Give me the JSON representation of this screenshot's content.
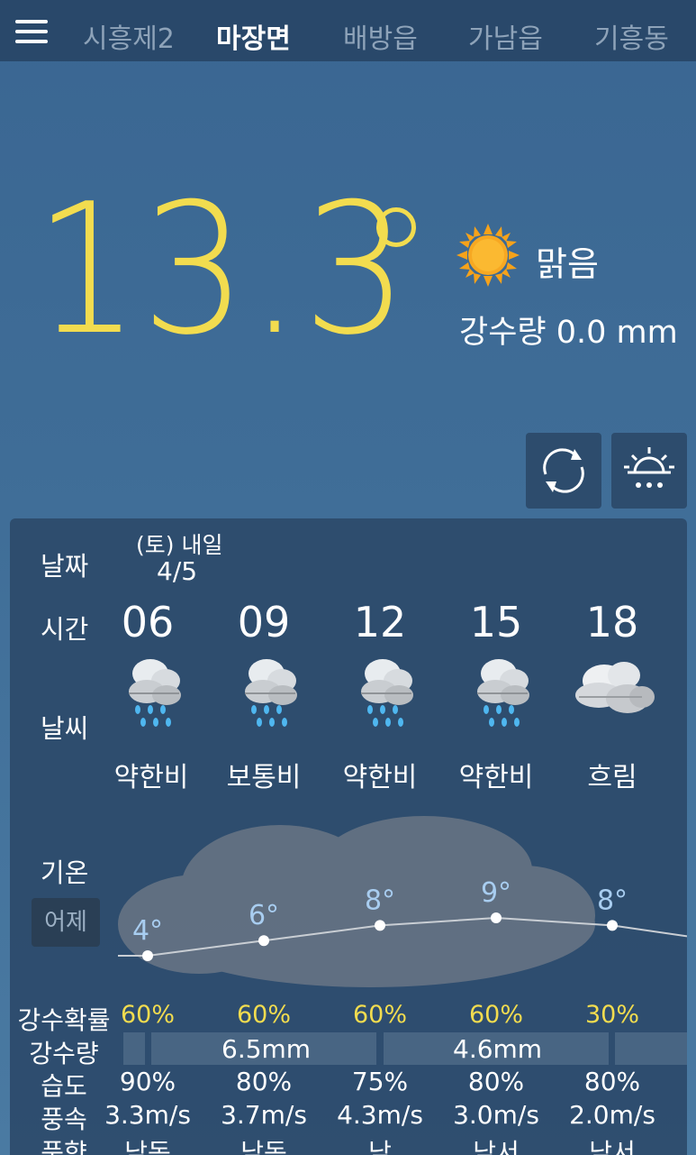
{
  "tabs": [
    "시흥제2",
    "마장면",
    "배방읍",
    "가남읍",
    "기흥동"
  ],
  "current": {
    "temp": "13.3",
    "condition": "맑음",
    "rain": "강수량 0.0 mm"
  },
  "labels": {
    "date": "날짜",
    "time": "시간",
    "weather": "날씨",
    "temp": "기온",
    "yesterday": "어제",
    "pop": "강수확률",
    "rain": "강수량",
    "humidity": "습도",
    "wind": "풍속",
    "wind_dir": "풍향"
  },
  "date": {
    "top": "(토) 내일",
    "bottom": "4/5"
  },
  "forecast": [
    {
      "hour": "06",
      "weather": "약한비",
      "icon": "rain-cloud-icon",
      "temp": "4°",
      "pop": "60%",
      "humidity": "90%",
      "wind": "3.3m/s",
      "wind_dir": "남동"
    },
    {
      "hour": "09",
      "weather": "보통비",
      "icon": "rain-cloud-icon",
      "temp": "6°",
      "pop": "60%",
      "humidity": "80%",
      "wind": "3.7m/s",
      "wind_dir": "남동"
    },
    {
      "hour": "12",
      "weather": "약한비",
      "icon": "rain-cloud-icon",
      "temp": "8°",
      "pop": "60%",
      "humidity": "75%",
      "wind": "4.3m/s",
      "wind_dir": "남"
    },
    {
      "hour": "15",
      "weather": "약한비",
      "icon": "rain-cloud-icon",
      "temp": "9°",
      "pop": "60%",
      "humidity": "80%",
      "wind": "3.0m/s",
      "wind_dir": "남서"
    },
    {
      "hour": "18",
      "weather": "흐림",
      "icon": "cloudy-icon",
      "temp": "8°",
      "pop": "30%",
      "humidity": "80%",
      "wind": "2.0m/s",
      "wind_dir": "남서"
    }
  ],
  "rain_amounts": [
    "6.5mm",
    "4.6mm"
  ],
  "colors": {
    "temp": "#f2dc4f",
    "topbar": "#29486a",
    "panel": "#2c4a6a",
    "temp_label": "#a8cdf0"
  }
}
